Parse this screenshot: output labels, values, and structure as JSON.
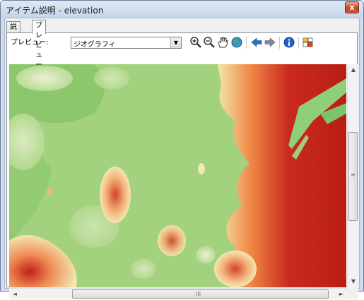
{
  "window": {
    "title": "アイテム説明 - elevation",
    "close_label": "x"
  },
  "tabs": [
    {
      "label": "説明",
      "active": false
    },
    {
      "label": "プレビュー",
      "active": true
    }
  ],
  "preview": {
    "label": "プレビュー:",
    "select_value": "ジオグラフィ",
    "select_arrow": "▼"
  },
  "toolbar": {
    "tools": [
      "zoom-in-icon",
      "zoom-out-icon",
      "pan-hand-icon",
      "full-extent-globe-icon",
      "back-arrow-icon",
      "forward-arrow-icon",
      "identify-info-icon",
      "create-thumbnail-icon"
    ]
  },
  "scrollbars": {
    "up_arrow": "▲",
    "down_arrow": "▼",
    "left_arrow": "◄",
    "right_arrow": "►",
    "v_grip": "≡",
    "h_grip": "III"
  },
  "colors": {
    "lowland": "#9fd07a",
    "mid": "#f2e6a8",
    "high": "#c0201a"
  }
}
